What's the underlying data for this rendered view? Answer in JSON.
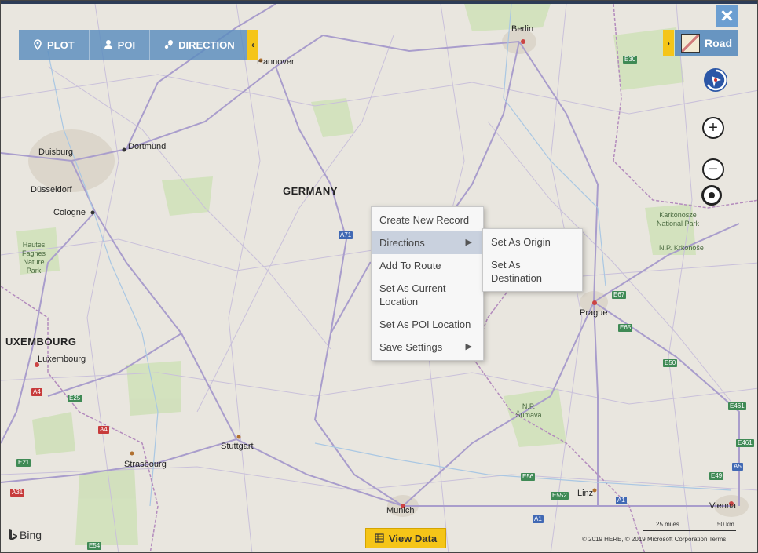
{
  "toolbar": {
    "plot": "PLOT",
    "poi": "POI",
    "direction": "DIRECTION"
  },
  "map_style": {
    "label": "Road"
  },
  "map_labels": {
    "countries": [
      "GERMANY",
      "UXEMBOURG"
    ],
    "cities": [
      "Berlin",
      "Hannover",
      "Dortmund",
      "Duisburg",
      "Düsseldorf",
      "Cologne",
      "Luxembourg",
      "Stuttgart",
      "Strasbourg",
      "Munich",
      "Prague",
      "Linz",
      "Vienna"
    ],
    "regions": [
      "Hautes Fagnes Nature Park",
      "Karkonosze National Park",
      "N.P. Krkonoše",
      "N.P. Šumava"
    ],
    "roads": [
      "A71",
      "E30",
      "E67",
      "E65",
      "E50",
      "E461",
      "E461",
      "A5",
      "E49",
      "A1",
      "E552",
      "E56",
      "A1",
      "A4",
      "A4",
      "E25",
      "E21",
      "A31",
      "E54"
    ]
  },
  "context_menu": {
    "items": [
      "Create New Record",
      "Directions",
      "Add To Route",
      "Set As Current Location",
      "Set As POI Location",
      "Save Settings"
    ]
  },
  "submenu": {
    "items": [
      "Set As Origin",
      "Set As Destination"
    ]
  },
  "bottom": {
    "view_data": "View Data",
    "bing": "Bing",
    "scale_miles": "25 miles",
    "scale_km": "50 km",
    "copyright": "© 2019 HERE, © 2019 Microsoft Corporation  Terms"
  },
  "colors": {
    "accent": "#f5c518",
    "toolbar": "#5a8cbe",
    "road_major": "#9c8fc4",
    "land": "#e9e6df",
    "park": "#c8dcb0"
  },
  "icons": [
    "pin-icon",
    "person-icon",
    "direction-icon",
    "close-icon",
    "zoom-in-icon",
    "zoom-out-icon",
    "locate-icon",
    "compass-icon",
    "table-icon",
    "bing-logo-icon"
  ]
}
